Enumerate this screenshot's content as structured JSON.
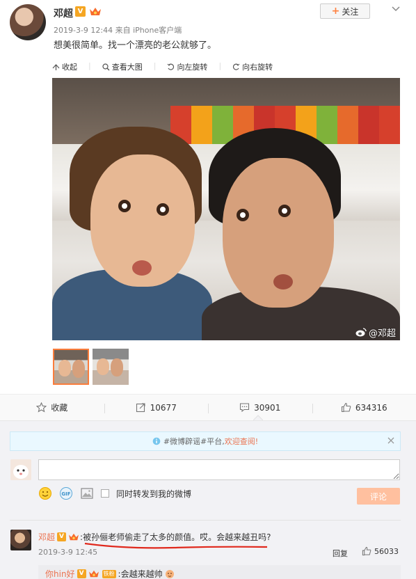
{
  "post": {
    "author": "邓超",
    "verified_badge": "V",
    "meta": "2019-3-9 12:44 来自 iPhone客户端",
    "text": "想美很简单。找一个漂亮的老公就够了。",
    "follow_label": "关注"
  },
  "image_toolbar": {
    "collapse": "收起",
    "view_large": "查看大图",
    "rotate_left": "向左旋转",
    "rotate_right": "向右旋转"
  },
  "photo": {
    "watermark": "@邓超"
  },
  "actions": {
    "favorite": "收藏",
    "reposts": "10677",
    "comments": "30901",
    "likes": "634316"
  },
  "comment_box": {
    "notice_prefix": "#微博辟谣#平台,",
    "notice_link": "欢迎查阅!",
    "repost_label": "同时转发到我的微博",
    "submit_label": "评论"
  },
  "comments": [
    {
      "user": "邓超",
      "verified_badge": "V",
      "separator": ":",
      "text": "被孙俪老师偷走了太多的颜值。哎。会越来越丑吗?",
      "time": "2019-3-9 12:45",
      "reply_label": "回复",
      "likes": "56033"
    }
  ],
  "sub_comment": {
    "user": "你hin好",
    "verified_badge": "V",
    "fan_badge": "铁粉",
    "separator": ":",
    "text": "会越来越帅"
  },
  "colors": {
    "accent": "#eb7350",
    "verified": "#f5a623",
    "thumb_border": "#fa7d3c",
    "submit_disabled": "#ffc09f"
  }
}
